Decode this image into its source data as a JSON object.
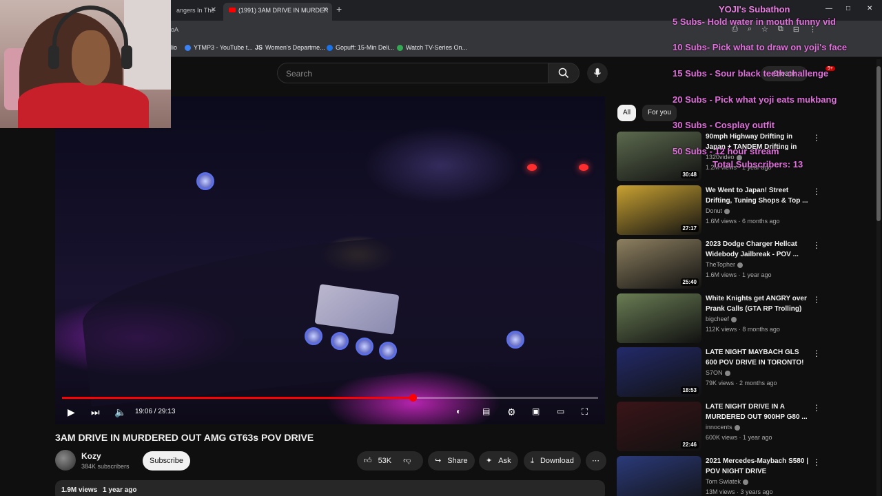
{
  "browser": {
    "tabs": [
      {
        "label": "angers In The"
      },
      {
        "label": "(1991) 3AM DRIVE IN MURDER"
      }
    ],
    "new_tab": "+",
    "window_controls": {
      "minimize": "—",
      "maximize": "□",
      "close": "✕"
    },
    "address_text": "oA",
    "bookmarks": [
      {
        "label": "lio",
        "color": "#888888"
      },
      {
        "label": "YTMP3 - YouTube t...",
        "color": "#3b82f6"
      },
      {
        "label": "Women's Departme...",
        "prefix": "JS",
        "color": "#e8eaed"
      },
      {
        "label": "Gopuff: 15-Min Deli...",
        "color": "#1a73e8"
      },
      {
        "label": "Watch TV-Series On...",
        "color": "#34a853"
      }
    ]
  },
  "youtube": {
    "search_placeholder": "Search",
    "create_label": "Create",
    "notification_count": "9+",
    "chips": [
      "All",
      "For you"
    ]
  },
  "player": {
    "time": "19:06 / 29:13",
    "progress": 0.654
  },
  "video": {
    "title": "3AM DRIVE IN MURDERED OUT AMG GT63s POV DRIVE",
    "channel": "Kozy",
    "subscribers": "384K subscribers",
    "subscribe_label": "Subscribe",
    "likes": "53K",
    "share_label": "Share",
    "ask_label": "Ask",
    "download_label": "Download",
    "views": "1.9M views",
    "age": "1 year ago"
  },
  "recommendations": [
    {
      "title": "90mph Highway Drifting in Japan + TANDEM Drifting in th...",
      "channel": "1320video",
      "meta": "1.2M views · 1 year ago",
      "duration": "30:48",
      "thumb": "#5c6a4e"
    },
    {
      "title": "We Went to Japan! Street Drifting, Tuning Shops & Top ...",
      "channel": "Donut",
      "meta": "1.6M views · 6 months ago",
      "duration": "27:17",
      "thumb": "#c9a232"
    },
    {
      "title": "2023 Dodge Charger Hellcat Widebody Jailbreak - POV ...",
      "channel": "TheTopher",
      "meta": "1.6M views · 1 year ago",
      "duration": "25:40",
      "thumb": "#8e8060"
    },
    {
      "title": "White Knights get ANGRY over Prank Calls (GTA RP Trolling)",
      "channel": "bigcheef",
      "meta": "112K views · 8 months ago",
      "duration": "",
      "thumb": "#6a7d54"
    },
    {
      "title": "LATE NIGHT MAYBACH GLS 600 POV DRIVE IN TORONTO!",
      "channel": "S7ON",
      "meta": "79K views · 2 months ago",
      "duration": "18:53",
      "thumb": "#232a6a"
    },
    {
      "title": "LATE NIGHT DRIVE IN A MURDERED OUT 900HP G80 ...",
      "channel": "innocents",
      "meta": "600K views · 1 year ago",
      "duration": "22:46",
      "thumb": "#3a1418"
    },
    {
      "title": "2021 Mercedes-Maybach S580 | POV NIGHT DRIVE",
      "channel": "Tom Swiatek",
      "meta": "13M views · 3 years ago",
      "duration": "",
      "thumb": "#2b3a7a"
    }
  ],
  "subathon": {
    "title": "YOJI's Subathon",
    "goals": [
      "5 Subs- Hold water in mouth funny vid",
      "10 Subs- Pick what to draw on yoji's face",
      "15 Subs - Sour black teeth challenge",
      "20 Subs - Pick what yoji eats mukbang",
      "30 Subs - Cosplay outfit",
      "50 Subs - 12 hour stream"
    ],
    "total": "Total Subscribers: 13"
  }
}
